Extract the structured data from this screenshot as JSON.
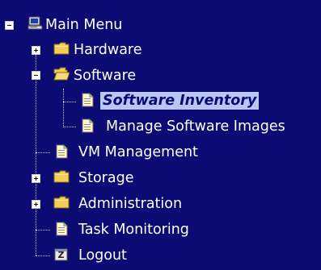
{
  "tree": {
    "root": {
      "label": "Main Menu",
      "icon": "computer-menu-icon",
      "state": "expanded"
    },
    "items": [
      {
        "label": "Hardware",
        "icon": "folder-closed-icon",
        "state": "collapsed"
      },
      {
        "label": "Software",
        "icon": "folder-open-icon",
        "state": "expanded",
        "children": [
          {
            "label": "Software Inventory",
            "icon": "document-icon",
            "selected": true
          },
          {
            "label": "Manage Software Images",
            "icon": "document-icon"
          }
        ]
      },
      {
        "label": "VM Management",
        "icon": "document-icon"
      },
      {
        "label": "Storage",
        "icon": "folder-closed-icon",
        "state": "collapsed"
      },
      {
        "label": "Administration",
        "icon": "folder-closed-icon",
        "state": "collapsed"
      },
      {
        "label": "Task Monitoring",
        "icon": "document-icon"
      },
      {
        "label": "Logout",
        "icon": "logout-icon"
      }
    ]
  },
  "colors": {
    "background": "#0b0b73",
    "text": "#ffffff",
    "selection_background": "#b9c5f3",
    "selection_text": "#0b0b73",
    "folder": "#f2cd57"
  }
}
